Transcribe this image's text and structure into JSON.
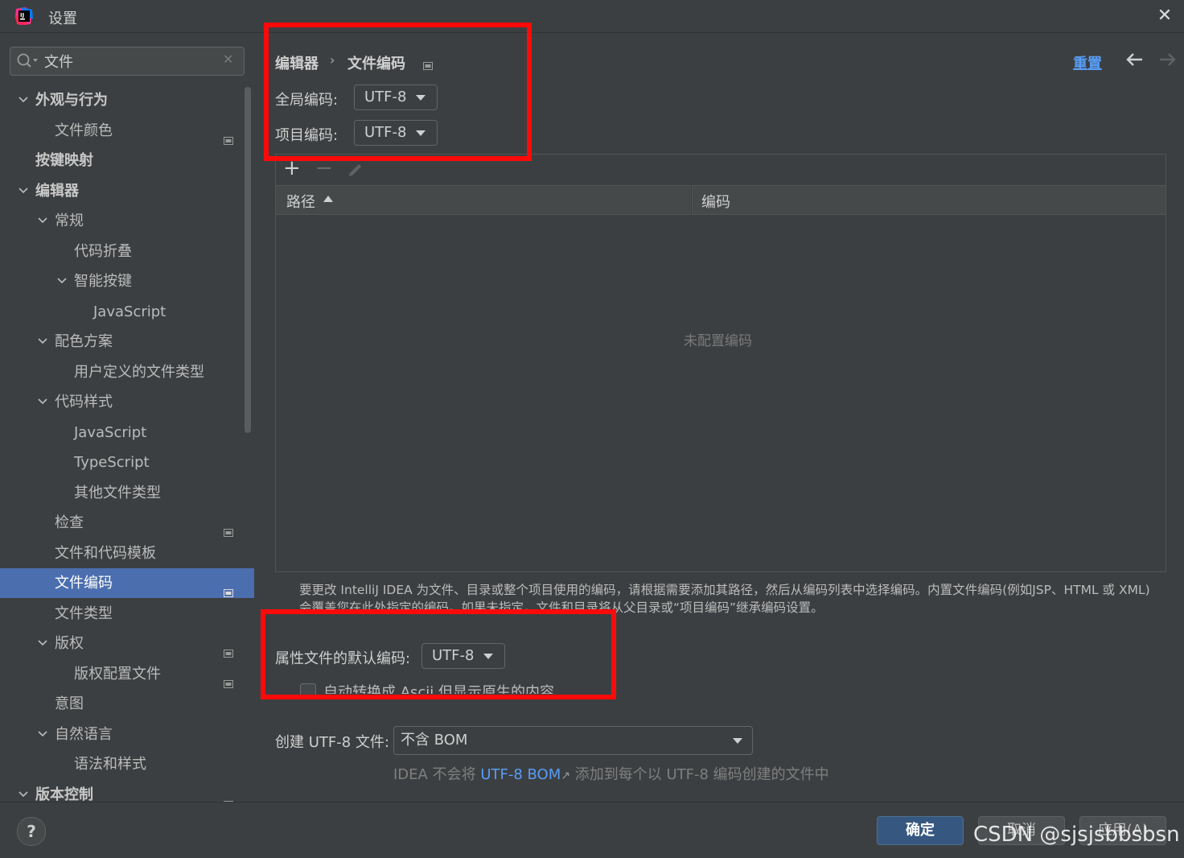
{
  "window": {
    "title": "设置",
    "close": "✕"
  },
  "search": {
    "value": "文件",
    "clear": "✕"
  },
  "tree": [
    {
      "label": "外观与行为",
      "level": 0,
      "expanded": true,
      "bold": true
    },
    {
      "label": "文件颜色",
      "level": 1,
      "project": true
    },
    {
      "label": "按键映射",
      "level": 0,
      "bold": true
    },
    {
      "label": "编辑器",
      "level": 0,
      "expanded": true,
      "bold": true
    },
    {
      "label": "常规",
      "level": 1,
      "expanded": true
    },
    {
      "label": "代码折叠",
      "level": 2
    },
    {
      "label": "智能按键",
      "level": 2,
      "expanded": true
    },
    {
      "label": "JavaScript",
      "level": 3
    },
    {
      "label": "配色方案",
      "level": 1,
      "expanded": true
    },
    {
      "label": "用户定义的文件类型",
      "level": 2
    },
    {
      "label": "代码样式",
      "level": 1,
      "expanded": true
    },
    {
      "label": "JavaScript",
      "level": 2
    },
    {
      "label": "TypeScript",
      "level": 2
    },
    {
      "label": "其他文件类型",
      "level": 2
    },
    {
      "label": "检查",
      "level": 1,
      "project": true
    },
    {
      "label": "文件和代码模板",
      "level": 1
    },
    {
      "label": "文件编码",
      "level": 1,
      "project": true,
      "selected": true
    },
    {
      "label": "文件类型",
      "level": 1
    },
    {
      "label": "版权",
      "level": 1,
      "expanded": true,
      "project": true
    },
    {
      "label": "版权配置文件",
      "level": 2,
      "project": true
    },
    {
      "label": "意图",
      "level": 1
    },
    {
      "label": "自然语言",
      "level": 1,
      "expanded": true
    },
    {
      "label": "语法和样式",
      "level": 2
    },
    {
      "label": "版本控制",
      "level": 0,
      "expanded": true,
      "bold": true,
      "project": true
    }
  ],
  "breadcrumb": {
    "parent": "编辑器",
    "separator": "›",
    "current": "文件编码"
  },
  "header": {
    "reset": "重置"
  },
  "encodings": {
    "global_label": "全局编码:",
    "global_value": "UTF-8",
    "project_label": "项目编码:",
    "project_value": "UTF-8"
  },
  "table": {
    "add": "+",
    "remove": "−",
    "col_path": "路径",
    "col_encoding": "编码",
    "empty": "未配置编码",
    "rows": []
  },
  "description": "要更改 IntelliJ IDEA 为文件、目录或整个项目使用的编码，请根据需要添加其路径，然后从编码列表中选择编码。内置文件编码(例如JSP、HTML 或 XML)会覆盖您在此处指定的编码。如果未指定，文件和目录将从父目录或“项目编码”继承编码设置。",
  "properties": {
    "label": "属性文件的默认编码:",
    "value": "UTF-8",
    "ascii_label": "自动转换成 Ascii 但显示原生的内容",
    "ascii_checked": false
  },
  "bom": {
    "label": "创建 UTF-8 文件:",
    "value": "不含 BOM",
    "hint_prefix": "IDEA 不会将",
    "hint_link": "UTF-8 BOM",
    "hint_arrow": "↗",
    "hint_suffix": "添加到每个以 UTF-8 编码创建的文件中"
  },
  "footer": {
    "help": "?",
    "ok": "确定",
    "cancel": "取消",
    "apply": "应用(A)"
  },
  "watermark": "CSDN @sjsjsbbsbsn",
  "colors": {
    "selection": "#4b6eaf",
    "link": "#589df6",
    "highlight": "#ff0a0a",
    "background": "#3c3f41"
  }
}
